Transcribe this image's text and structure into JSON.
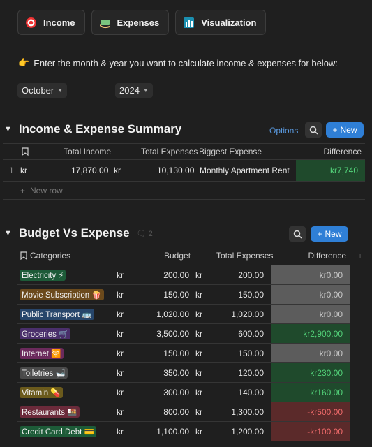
{
  "nav": {
    "income_label": "Income",
    "expenses_label": "Expenses",
    "visualization_label": "Visualization"
  },
  "intro_text": "Enter the month & year you want to calculate income & expenses for below:",
  "month_select": "October",
  "year_select": "2024",
  "summary": {
    "title": "Income & Expense Summary",
    "options_label": "Options",
    "new_label": "New",
    "columns": [
      "Total Income",
      "Total Expenses",
      "Biggest Expense",
      "Difference"
    ],
    "row_number": "1",
    "currency": "kr",
    "total_income": "17,870.00",
    "total_expenses": "10,130.00",
    "biggest_expense": "Monthly Apartment Rent",
    "difference": "kr7,740",
    "new_row_label": "New row"
  },
  "budget": {
    "title": "Budget Vs Expense",
    "comment_count": "2",
    "new_label": "New",
    "columns": [
      "Categories",
      "Budget",
      "Total Expenses",
      "Difference"
    ],
    "currency": "kr",
    "rows": [
      {
        "category": "Electricity ⚡",
        "tag_color": "#1d5b38",
        "budget": "200.00",
        "expenses": "200.00",
        "difference": "kr0.00",
        "status": "n"
      },
      {
        "category": "Movie Subscription 🍿",
        "tag_color": "#6b4a1c",
        "budget": "150.00",
        "expenses": "150.00",
        "difference": "kr0.00",
        "status": "n"
      },
      {
        "category": "Public Transport 🚌",
        "tag_color": "#27466b",
        "budget": "1,020.00",
        "expenses": "1,020.00",
        "difference": "kr0.00",
        "status": "n"
      },
      {
        "category": "Groceries 🛒",
        "tag_color": "#4a2f6b",
        "budget": "3,500.00",
        "expenses": "600.00",
        "difference": "kr2,900.00",
        "status": "g"
      },
      {
        "category": "Internet 🛜",
        "tag_color": "#6b2a5c",
        "budget": "150.00",
        "expenses": "150.00",
        "difference": "kr0.00",
        "status": "n"
      },
      {
        "category": "Toiletries 🛁",
        "tag_color": "#4a4a4a",
        "budget": "350.00",
        "expenses": "120.00",
        "difference": "kr230.00",
        "status": "g"
      },
      {
        "category": "Vitamin 💊",
        "tag_color": "#6b5a1c",
        "budget": "300.00",
        "expenses": "140.00",
        "difference": "kr160.00",
        "status": "g"
      },
      {
        "category": "Restaurants 🍱",
        "tag_color": "#6b2a3a",
        "budget": "800.00",
        "expenses": "1,300.00",
        "difference": "-kr500.00",
        "status": "r"
      },
      {
        "category": "Credit Card Debt 💳",
        "tag_color": "#1d5b38",
        "budget": "1,100.00",
        "expenses": "1,200.00",
        "difference": "-kr100.00",
        "status": "r"
      }
    ]
  }
}
